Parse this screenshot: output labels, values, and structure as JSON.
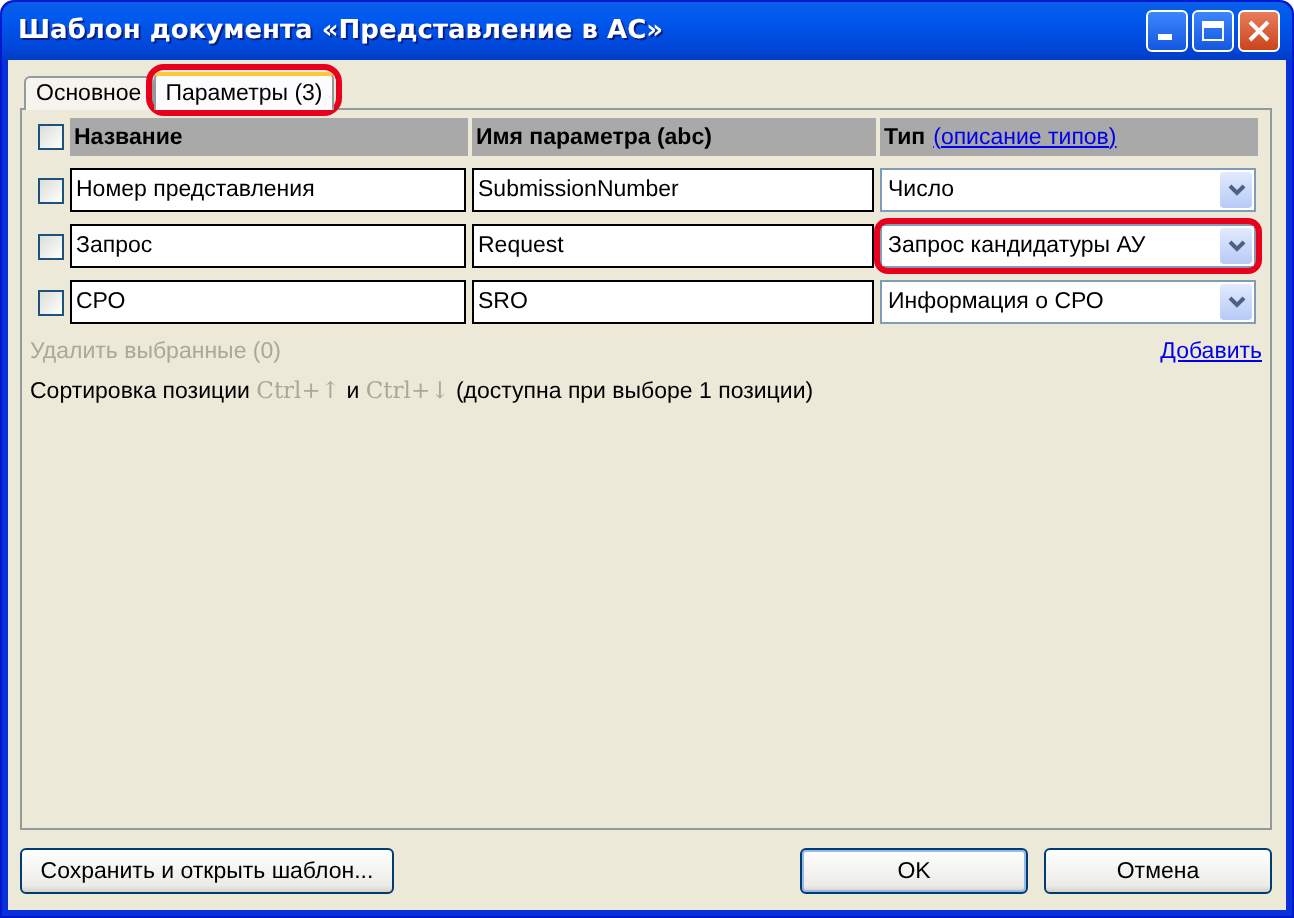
{
  "window": {
    "title": "Шаблон документа «Представление в АС»"
  },
  "tabs": [
    {
      "label": "Основное",
      "selected": false,
      "highlighted": false
    },
    {
      "label": "Параметры (3)",
      "selected": true,
      "highlighted": true
    }
  ],
  "table": {
    "select_all": {
      "checked": false
    },
    "columns": [
      {
        "label": "Название"
      },
      {
        "label": "Имя параметра (abc)"
      },
      {
        "label": "Тип",
        "link": "(описание типов)"
      }
    ],
    "rows": [
      {
        "checked": false,
        "name": "Номер представления",
        "param": "SubmissionNumber",
        "type": "Число",
        "highlighted": false
      },
      {
        "checked": false,
        "name": "Запрос",
        "param": "Request",
        "type": "Запрос кандидатуры АУ",
        "highlighted": true
      },
      {
        "checked": false,
        "name": "СРО",
        "param": "SRO",
        "type": "Информация о СРО",
        "highlighted": false
      }
    ]
  },
  "delete_selected": {
    "label": "Удалить выбранные (0)",
    "disabled": true
  },
  "add_link": "Добавить",
  "sort_hint": [
    {
      "kind": "plain",
      "text": "Сортировка позиции"
    },
    {
      "kind": "key",
      "text": "Ctrl+↑"
    },
    {
      "kind": "plain",
      "text": "и"
    },
    {
      "kind": "key",
      "text": "Ctrl+↓"
    },
    {
      "kind": "plain",
      "text": "(доступна при выборе 1 позиции)"
    }
  ],
  "buttons": [
    {
      "label": "Сохранить и открыть шаблон...",
      "kind": "secondary"
    },
    {
      "label": "OK",
      "kind": "default"
    },
    {
      "label": "Отмена",
      "kind": "normal"
    }
  ]
}
